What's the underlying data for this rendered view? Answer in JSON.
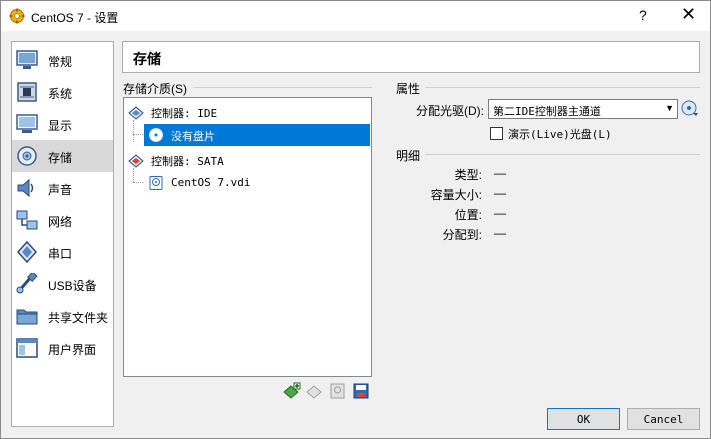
{
  "window": {
    "title": "CentOS 7 - 设置",
    "help": "?",
    "close": "✕"
  },
  "sidebar": {
    "items": [
      {
        "label": "常规",
        "icon": "general-icon"
      },
      {
        "label": "系统",
        "icon": "system-icon"
      },
      {
        "label": "显示",
        "icon": "display-icon"
      },
      {
        "label": "存储",
        "icon": "storage-icon",
        "selected": true
      },
      {
        "label": "声音",
        "icon": "audio-icon"
      },
      {
        "label": "网络",
        "icon": "network-icon"
      },
      {
        "label": "串口",
        "icon": "serial-port-icon"
      },
      {
        "label": "USB设备",
        "icon": "usb-icon"
      },
      {
        "label": "共享文件夹",
        "icon": "shared-folder-icon"
      },
      {
        "label": "用户界面",
        "icon": "user-interface-icon"
      }
    ]
  },
  "header": {
    "title": "存储"
  },
  "storage": {
    "section_label": "存储介质(S)",
    "tree": {
      "controller_ide": "控制器: IDE",
      "ide_disk": "没有盘片",
      "controller_sata": "控制器: SATA",
      "sata_disk": "CentOS 7.vdi"
    }
  },
  "attributes": {
    "section_label": "属性",
    "drive_label": "分配光驱(D):",
    "drive_value": "第二IDE控制器主通道",
    "live_cd_label": "演示(Live)光盘(L)",
    "live_cd_checked": false
  },
  "details": {
    "section_label": "明细",
    "rows": [
      {
        "label": "类型:",
        "value": "—"
      },
      {
        "label": "容量大小:",
        "value": "—"
      },
      {
        "label": "位置:",
        "value": "—"
      },
      {
        "label": "分配到:",
        "value": "—"
      }
    ]
  },
  "buttons": {
    "ok": "OK",
    "cancel": "Cancel"
  },
  "colors": {
    "selection": "#0078d7",
    "accent_green": "#3a9e3a"
  }
}
